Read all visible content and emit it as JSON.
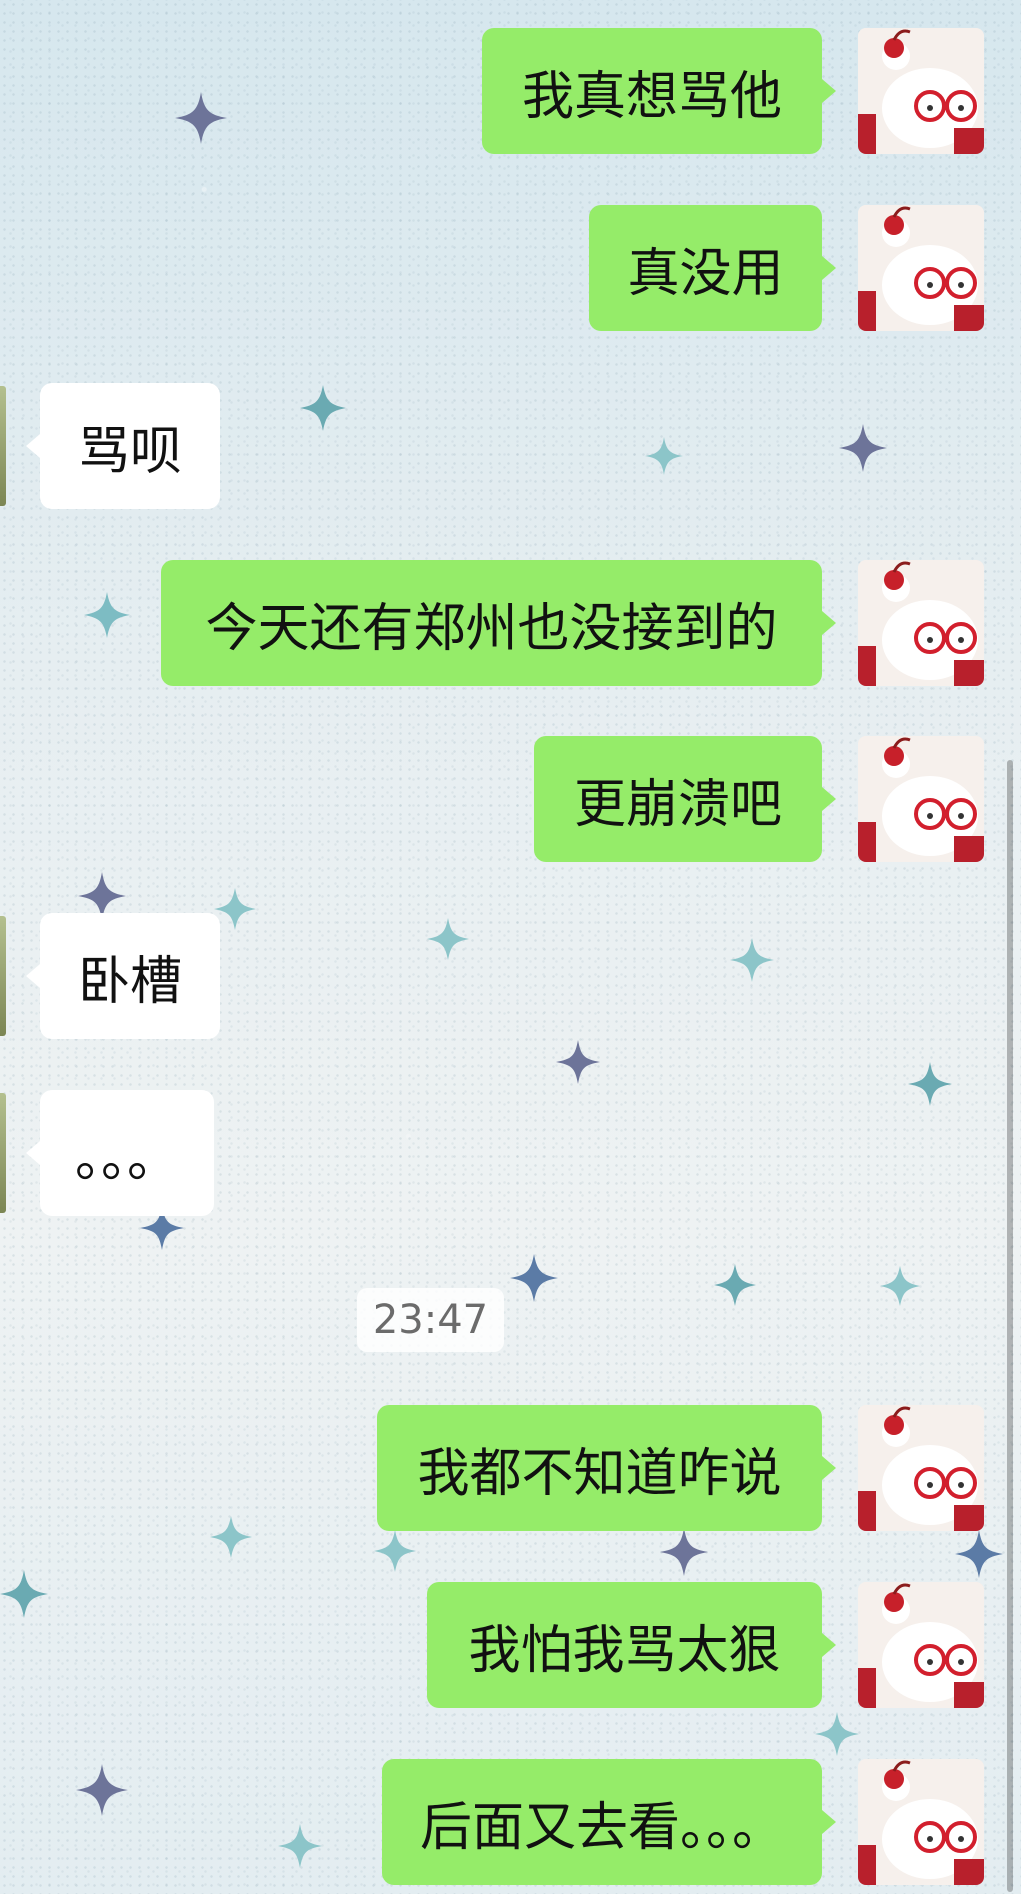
{
  "messages": [
    {
      "side": "right",
      "text": "我真想骂他"
    },
    {
      "side": "right",
      "text": "真没用"
    },
    {
      "side": "left",
      "text": "骂呗"
    },
    {
      "side": "right",
      "text": "今天还有郑州也没接到的"
    },
    {
      "side": "right",
      "text": "更崩溃吧"
    },
    {
      "side": "left",
      "text": "卧槽"
    },
    {
      "side": "left",
      "text": "。。。"
    },
    {
      "side": "right",
      "text": "我都不知道咋说"
    },
    {
      "side": "right",
      "text": "我怕我骂太狠"
    },
    {
      "side": "right",
      "text": "后面又去看。。。"
    }
  ],
  "timestamp": "23:47",
  "colors": {
    "outgoing_bubble": "#95ec69",
    "incoming_bubble": "#ffffff",
    "timestamp_text": "#6b6b6b"
  },
  "icons": {
    "avatar": "bunny-cake-avatar-icon",
    "sparkle": "sparkle-star-icon"
  }
}
